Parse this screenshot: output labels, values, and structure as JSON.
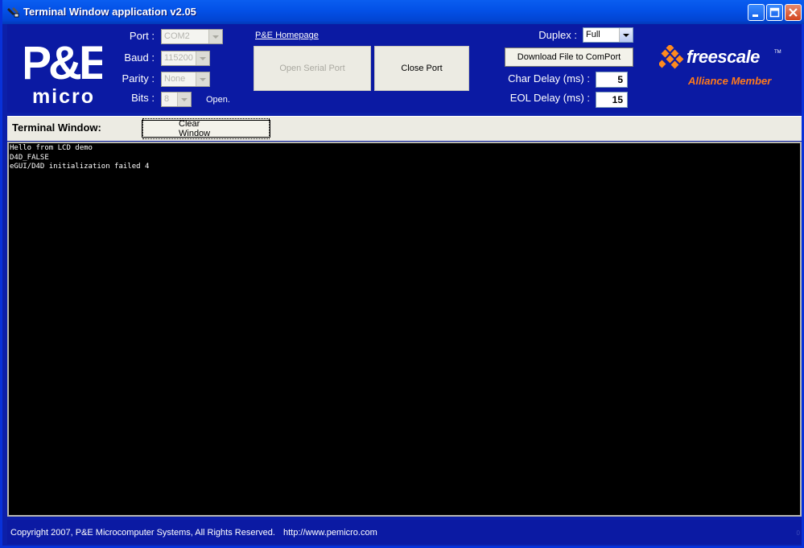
{
  "window": {
    "title": "Terminal Window application v2.05"
  },
  "logo": {
    "line1": "P&E",
    "line2": "micro"
  },
  "settings": {
    "port_label": "Port :",
    "port_value": "COM2",
    "baud_label": "Baud :",
    "baud_value": "115200",
    "parity_label": "Parity :",
    "parity_value": "None",
    "bits_label": "Bits :",
    "bits_value": "8",
    "status": "Open."
  },
  "links": {
    "homepage": "P&E Homepage"
  },
  "buttons": {
    "open_serial_port": "Open Serial Port",
    "close_port": "Close Port",
    "download_file": "Download File to ComPort",
    "clear_window": "Clear Window"
  },
  "duplex": {
    "label": "Duplex :",
    "value": "Full"
  },
  "delays": {
    "char_label": "Char Delay (ms) :",
    "char_value": "5",
    "eol_label": "EOL Delay (ms) :",
    "eol_value": "15"
  },
  "sponsor": {
    "name": "freescale",
    "tm": "TM",
    "subtitle": "Alliance Member"
  },
  "terminal": {
    "label": "Terminal Window:",
    "lines": [
      "Hello from LCD demo",
      "D4D_FALSE",
      "eGUI/D4D initialization failed 4"
    ]
  },
  "footer": {
    "copyright": "Copyright 2007, P&E Microcomputer Systems, All Rights Reserved.",
    "url": "http://www.pemicro.com",
    "corner": "0"
  },
  "colors": {
    "header_bg": "#0b1aa3",
    "title_bar": "#0350e6",
    "freescale_orange": "#ff7a1a"
  }
}
